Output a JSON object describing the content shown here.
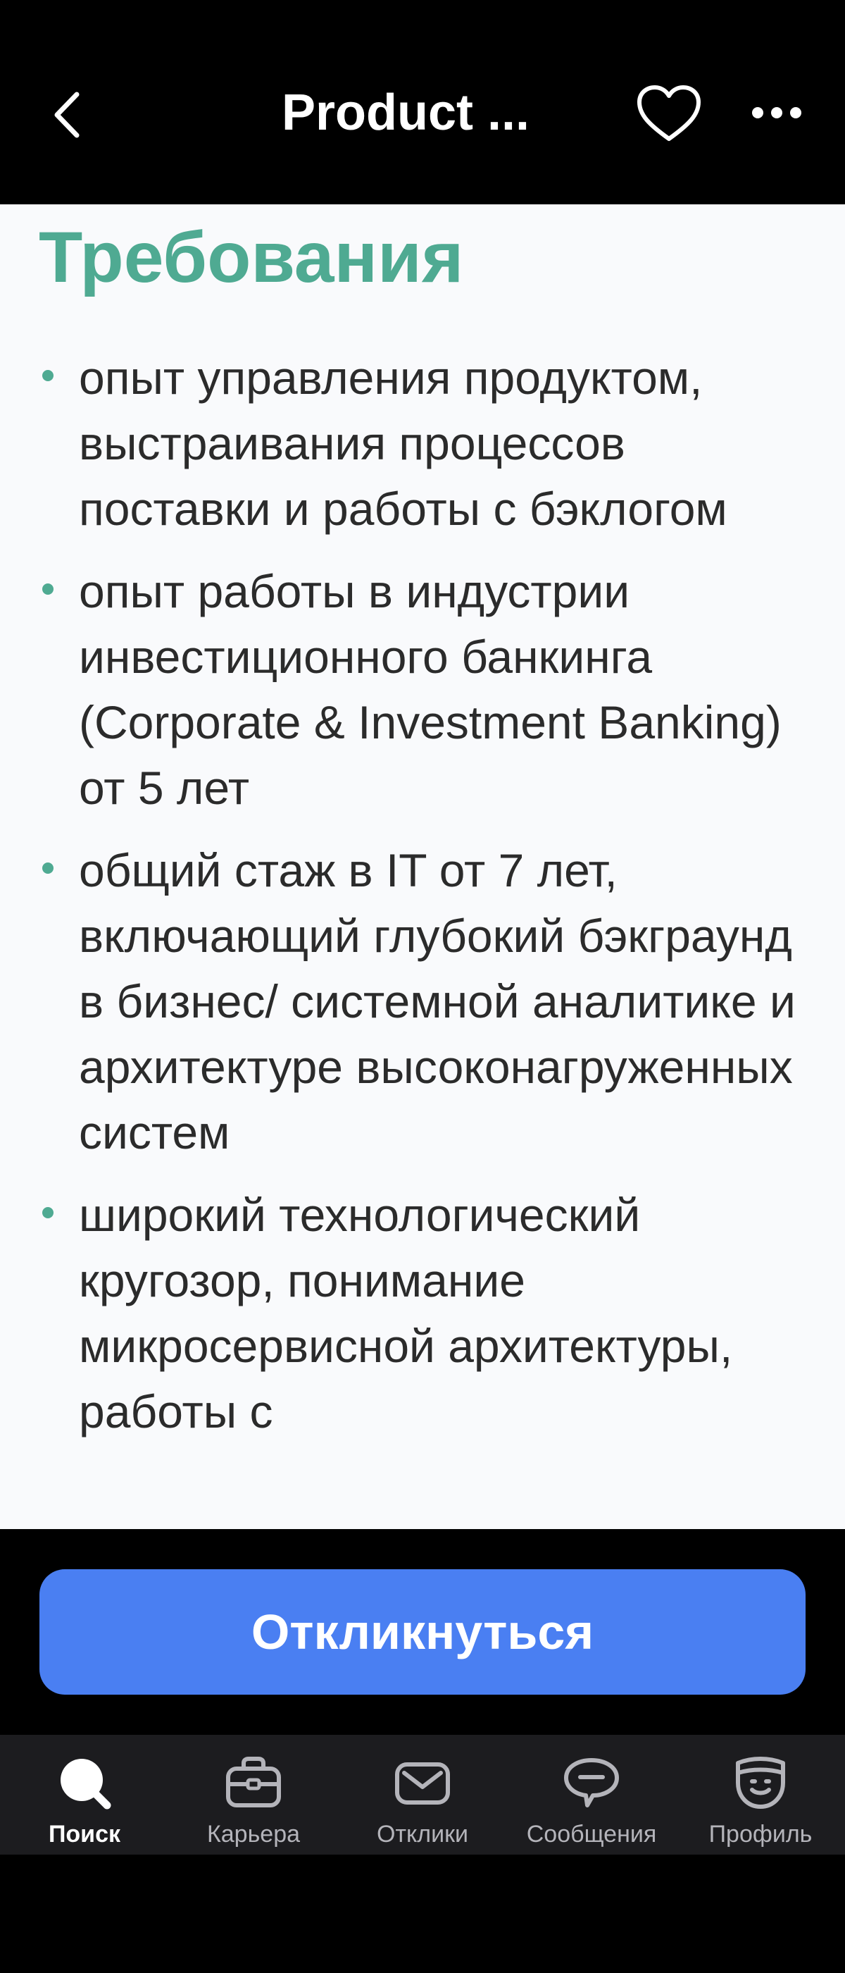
{
  "header": {
    "title": "Product ..."
  },
  "section": {
    "title": "Требования",
    "items": [
      "опыт управления продуктом, выстраивания процессов поставки и работы с бэклогом",
      "опыт работы в индустрии инвестиционного банкинга (Corporate & Investment Banking) от 5 лет",
      "общий стаж в IT от 7 лет, включающий глубокий бэкграунд в бизнес/ системной аналитике и архитектуре высоконагруженных систем",
      "широкий технологический кругозор, понимание микросервисной архитектуры, работы с"
    ]
  },
  "actions": {
    "respond_label": "Откликнуться"
  },
  "tabs": [
    {
      "label": "Поиск",
      "icon": "search-icon",
      "active": true
    },
    {
      "label": "Карьера",
      "icon": "briefcase-icon",
      "active": false
    },
    {
      "label": "Отклики",
      "icon": "envelope-icon",
      "active": false
    },
    {
      "label": "Сообщения",
      "icon": "chat-bubble-icon",
      "active": false
    },
    {
      "label": "Профиль",
      "icon": "profile-face-icon",
      "active": false
    }
  ],
  "colors": {
    "accent": "#4faa92",
    "button": "#4a7ff2",
    "background": "#f9fafc"
  }
}
